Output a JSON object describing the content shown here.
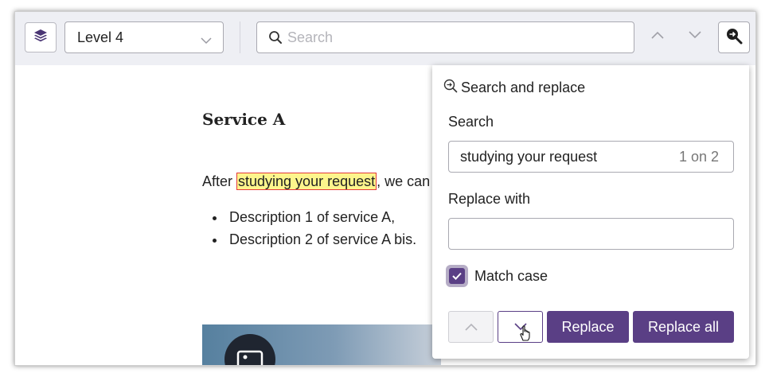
{
  "toolbar": {
    "layers_icon": "layers-icon",
    "level_select": {
      "value": "Level 4",
      "icon": "chevron-down-icon"
    },
    "search": {
      "placeholder": "Search",
      "value": "",
      "icon": "search-icon"
    },
    "prev_icon": "chevron-up-icon",
    "next_icon": "chevron-down-icon",
    "search_replace_icon": "search-replace-icon"
  },
  "document": {
    "heading": "Service A",
    "paragraph": {
      "before": "After ",
      "highlight": "studying your request",
      "after": ", we can"
    },
    "list": [
      "Description 1 of service A,",
      "Description 2 of service A bis."
    ],
    "image_icon": "image-icon"
  },
  "panel": {
    "title": "Search and replace",
    "title_icon": "search-replace-icon",
    "search_label": "Search",
    "search_value": "studying your request",
    "search_count": "1 on 2",
    "replace_label": "Replace with",
    "replace_value": "",
    "match_case_label": "Match case",
    "match_case_checked": true,
    "replace_button": "Replace",
    "replace_all_button": "Replace all"
  },
  "colors": {
    "accent": "#5a3f85",
    "highlight_bg": "#fdf58c",
    "highlight_border": "#e33a3a",
    "toolbar_bg": "#eeeff4"
  }
}
